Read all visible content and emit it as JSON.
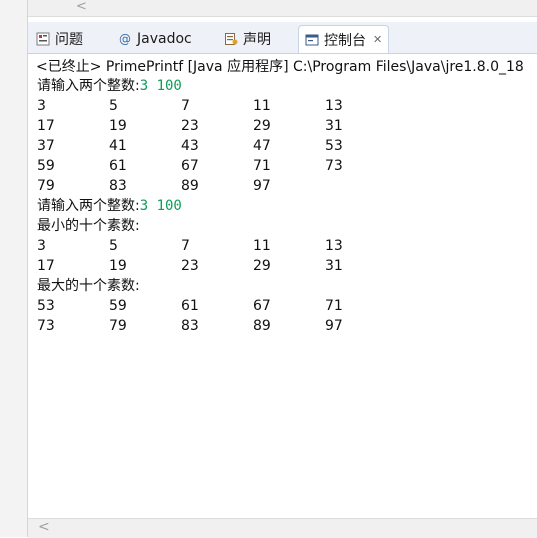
{
  "tabs": [
    {
      "label": "问题",
      "icon": "problems-icon"
    },
    {
      "label": "Javadoc",
      "icon": "javadoc-icon"
    },
    {
      "label": "声明",
      "icon": "declaration-icon"
    },
    {
      "label": "控制台",
      "icon": "console-icon",
      "active": true
    }
  ],
  "console": {
    "title": "<已终止> PrimePrintf [Java 应用程序] C:\\Program Files\\Java\\jre1.8.0_18",
    "prompt1": "请输入两个整数:",
    "input1": "3 100",
    "primes_rows": [
      [
        "3",
        "5",
        "7",
        "11",
        "13"
      ],
      [
        "17",
        "19",
        "23",
        "29",
        "31"
      ],
      [
        "37",
        "41",
        "43",
        "47",
        "53"
      ],
      [
        "59",
        "61",
        "67",
        "71",
        "73"
      ],
      [
        "79",
        "83",
        "89",
        "97"
      ]
    ],
    "prompt2": "请输入两个整数:",
    "input2": "3 100",
    "smallest_label": "最小的十个素数:",
    "smallest_rows": [
      [
        "3",
        "5",
        "7",
        "11",
        "13"
      ],
      [
        "17",
        "19",
        "23",
        "29",
        "31"
      ]
    ],
    "largest_label": "最大的十个素数:",
    "largest_rows": [
      [
        "53",
        "59",
        "61",
        "67",
        "71"
      ],
      [
        "73",
        "79",
        "83",
        "89",
        "97"
      ]
    ]
  },
  "scrollbar_arrow": "<"
}
